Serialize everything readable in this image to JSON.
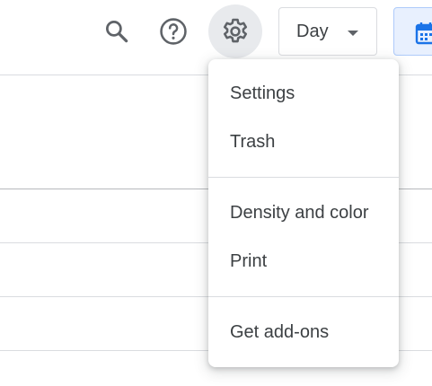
{
  "toolbar": {
    "search_icon": "search-icon",
    "help_icon": "help-icon",
    "settings_icon": "gear-icon",
    "view_select": {
      "selected": "Day"
    },
    "calendar_toggle_icon": "calendar-icon"
  },
  "settings_menu": {
    "items": [
      {
        "label": "Settings"
      },
      {
        "label": "Trash"
      },
      {
        "label": "Density and color"
      },
      {
        "label": "Print"
      },
      {
        "label": "Get add-ons"
      }
    ]
  },
  "colors": {
    "icon": "#5f6368",
    "text": "#3c4043",
    "divider": "#dadce0",
    "active_icon_bg": "#e8eaed",
    "accent": "#1a73e8",
    "accent_bg": "#e8f0fe"
  }
}
